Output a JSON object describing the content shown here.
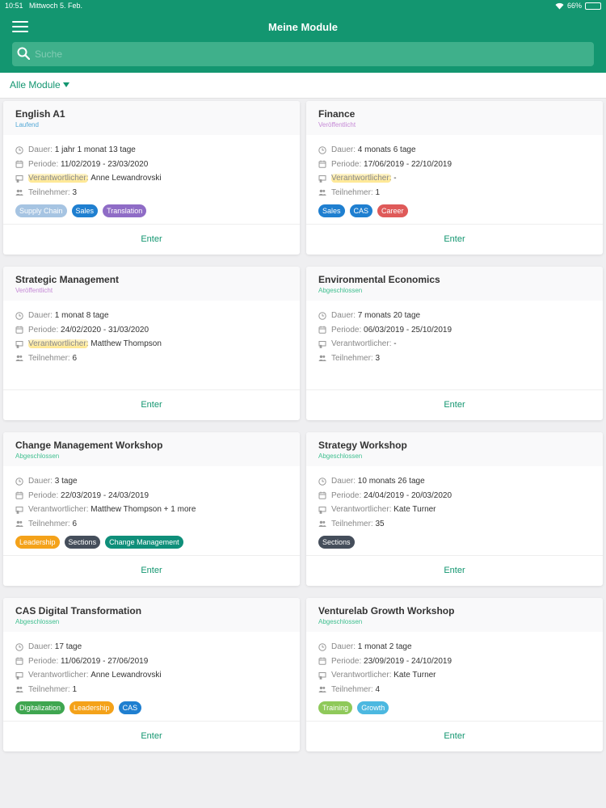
{
  "status_bar": {
    "time": "10:51",
    "date": "Mittwoch 5. Feb.",
    "battery": "66%",
    "battery_level": 0.66
  },
  "header": {
    "title": "Meine Module",
    "menu_icon": "hamburger-menu-icon"
  },
  "search": {
    "placeholder": "Suche",
    "value": ""
  },
  "filter": {
    "label": "Alle Module"
  },
  "labels": {
    "dauer": "Dauer:",
    "periode": "Periode:",
    "verantwortlicher": "Verantwortlicher:",
    "teilnehmer": "Teilnehmer:",
    "enter": "Enter"
  },
  "colors": {
    "primary": "#139670",
    "laufend": "#52a8d6",
    "veroeffentlicht": "#c589d6",
    "abgeschlossen": "#3fbf8f"
  },
  "modules": [
    {
      "title": "English A1",
      "status": "Laufend",
      "status_color": "#52a8d6",
      "dauer": "1 jahr  1 monat  13 tage",
      "periode": "11/02/2019 - 23/03/2020",
      "verantwortlicher": "Anne Lewandrovski",
      "teilnehmer": "3",
      "tags": [
        {
          "label": "Supply Chain",
          "color": "#a6c4e2"
        },
        {
          "label": "Sales",
          "color": "#1f7fd0"
        },
        {
          "label": "Translation",
          "color": "#8f6cc6"
        }
      ]
    },
    {
      "title": "Finance",
      "status": "Veröffentlicht",
      "status_color": "#c589d6",
      "dauer": "4 monats  6 tage",
      "periode": "17/06/2019 - 22/10/2019",
      "verantwortlicher": "-",
      "teilnehmer": "1",
      "tags": [
        {
          "label": "Sales",
          "color": "#1f7fd0"
        },
        {
          "label": "CAS",
          "color": "#1f7fd0"
        },
        {
          "label": "Career",
          "color": "#df5a59"
        }
      ]
    },
    {
      "title": "Strategic Management",
      "status": "Veröffentlicht",
      "status_color": "#c589d6",
      "dauer": "1 monat  8 tage",
      "periode": "24/02/2020 - 31/03/2020",
      "verantwortlicher": "Matthew Thompson",
      "teilnehmer": "6",
      "tags": []
    },
    {
      "title": "Environmental Economics",
      "status": "Abgeschlossen",
      "status_color": "#3fbf8f",
      "dauer": "7 monats  20 tage",
      "periode": "06/03/2019 - 25/10/2019",
      "verantwortlicher": "-",
      "teilnehmer": "3",
      "tags": []
    },
    {
      "title": "Change Management Workshop",
      "status": "Abgeschlossen",
      "status_color": "#3fbf8f",
      "dauer": "3 tage",
      "periode": "22/03/2019 - 24/03/2019",
      "verantwortlicher": "Matthew Thompson + 1 more",
      "teilnehmer": "6",
      "tags": [
        {
          "label": "Leadership",
          "color": "#f4a21a"
        },
        {
          "label": "Sections",
          "color": "#454e5b"
        },
        {
          "label": "Change Management",
          "color": "#0f8f7a"
        }
      ]
    },
    {
      "title": "Strategy Workshop",
      "status": "Abgeschlossen",
      "status_color": "#3fbf8f",
      "dauer": "10 monats  26 tage",
      "periode": "24/04/2019 - 20/03/2020",
      "verantwortlicher": "Kate Turner",
      "teilnehmer": "35",
      "tags": [
        {
          "label": "Sections",
          "color": "#454e5b"
        }
      ]
    },
    {
      "title": "CAS Digital Transformation",
      "status": "Abgeschlossen",
      "status_color": "#3fbf8f",
      "dauer": "17 tage",
      "periode": "11/06/2019 - 27/06/2019",
      "verantwortlicher": "Anne Lewandrovski",
      "teilnehmer": "1",
      "tags": [
        {
          "label": "Digitalization",
          "color": "#3fa650"
        },
        {
          "label": "Leadership",
          "color": "#f4a21a"
        },
        {
          "label": "CAS",
          "color": "#1f7fd0"
        }
      ]
    },
    {
      "title": "Venturelab Growth Workshop",
      "status": "Abgeschlossen",
      "status_color": "#3fbf8f",
      "dauer": "1 monat  2 tage",
      "periode": "23/09/2019 - 24/10/2019",
      "verantwortlicher": "Kate Turner",
      "teilnehmer": "4",
      "tags": [
        {
          "label": "Training",
          "color": "#8fc95a"
        },
        {
          "label": "Growth",
          "color": "#4cb8e0"
        }
      ]
    }
  ]
}
